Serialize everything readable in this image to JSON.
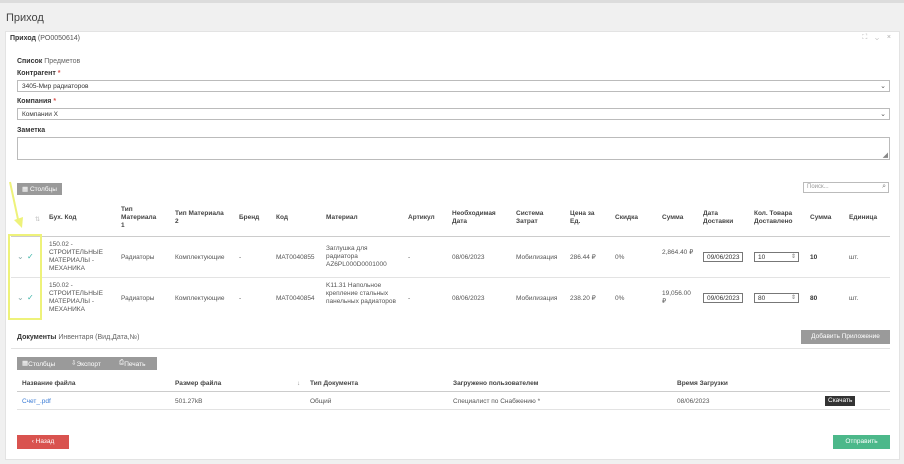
{
  "page": {
    "title": "Приход"
  },
  "panel": {
    "title": "Приход",
    "code": "(PO0050614)",
    "window_controls": "⛶ ⌄ ×"
  },
  "form": {
    "list_label": "Список",
    "list_sub": "Предметов",
    "counterparty_label": "Контрагент",
    "required_mark": "*",
    "counterparty_value": "3405-Мир радиаторов",
    "company_label": "Компания",
    "company_value": "Компании Х",
    "note_label": "Заметка",
    "chevron": "⌄",
    "resize_grip": "◢"
  },
  "items_table": {
    "columns_button": "Столбцы",
    "search_placeholder": "Поиск...",
    "headers": {
      "acc_code": "Бух. Код",
      "mat_type1": "Тип Материала 1",
      "mat_type2": "Тип Материала 2",
      "brand": "Бренд",
      "code": "Код",
      "material": "Материал",
      "article": "Артикул",
      "needed_date": "Необходимая Дата",
      "cost_system": "Система Затрат",
      "unit_price": "Цена за Ед.",
      "discount": "Скидка",
      "sum": "Сумма",
      "delivery_date": "Дата Доставки",
      "qty_delivered": "Кол. Товара Доставлено",
      "sum2": "Сумма",
      "unit": "Единица"
    },
    "rows": [
      {
        "acc_code": "150.02 - СТРОИТЕЛЬНЫЕ МАТЕРИАЛЫ - МЕХАНИКА",
        "mat_type1": "Радиаторы",
        "mat_type2": "Комплектующие",
        "brand": "-",
        "code": "MAT0040855",
        "material": "Заглушка для радиатора AZ6PL000D0001000",
        "article": "-",
        "needed_date": "08/06/2023",
        "cost_system": "Мобилизация",
        "unit_price": "286.44 ₽",
        "discount": "0%",
        "sum": "2,864.40 ₽",
        "delivery_date": "09/06/2023",
        "qty": "10",
        "sum2": "10",
        "unit": "шт."
      },
      {
        "acc_code": "150.02 - СТРОИТЕЛЬНЫЕ МАТЕРИАЛЫ - МЕХАНИКА",
        "mat_type1": "Радиаторы",
        "mat_type2": "Комплектующие",
        "brand": "-",
        "code": "MAT0040854",
        "material": "K11.31 Напольное крепление стальных панельных радиаторов",
        "article": "-",
        "needed_date": "08/06/2023",
        "cost_system": "Мобилизация",
        "unit_price": "238.20 ₽",
        "discount": "0%",
        "sum": "19,056.00 ₽",
        "delivery_date": "09/06/2023",
        "qty": "80",
        "sum2": "80",
        "unit": "шт."
      }
    ]
  },
  "documents": {
    "label": "Документы",
    "sub": "Инвентаря (Вид,Дата,№)",
    "add_button": "Добавить Приложение",
    "toolbar": {
      "columns": "Столбцы",
      "export": "Экспорт",
      "print": "Печать"
    },
    "headers": {
      "file_name": "Название файла",
      "file_size": "Размер файла",
      "doc_type": "Тип Документа",
      "uploaded_by": "Загружено пользователем",
      "upload_time": "Время Загрузки"
    },
    "rows": [
      {
        "file_name": "Счет_.pdf",
        "file_size": "501.27kB",
        "doc_type": "Общий",
        "uploaded_by": "Специалист по Снабжению *",
        "upload_time": "08/06/2023",
        "download": "Скачать"
      }
    ]
  },
  "footer": {
    "back": "Назад",
    "send": "Отправить"
  },
  "colors": {
    "accent_teal": "#3ab4a6",
    "danger": "#d9534f",
    "success": "#4cb88a",
    "link": "#3a7bd5",
    "highlight": "#eef27a"
  }
}
